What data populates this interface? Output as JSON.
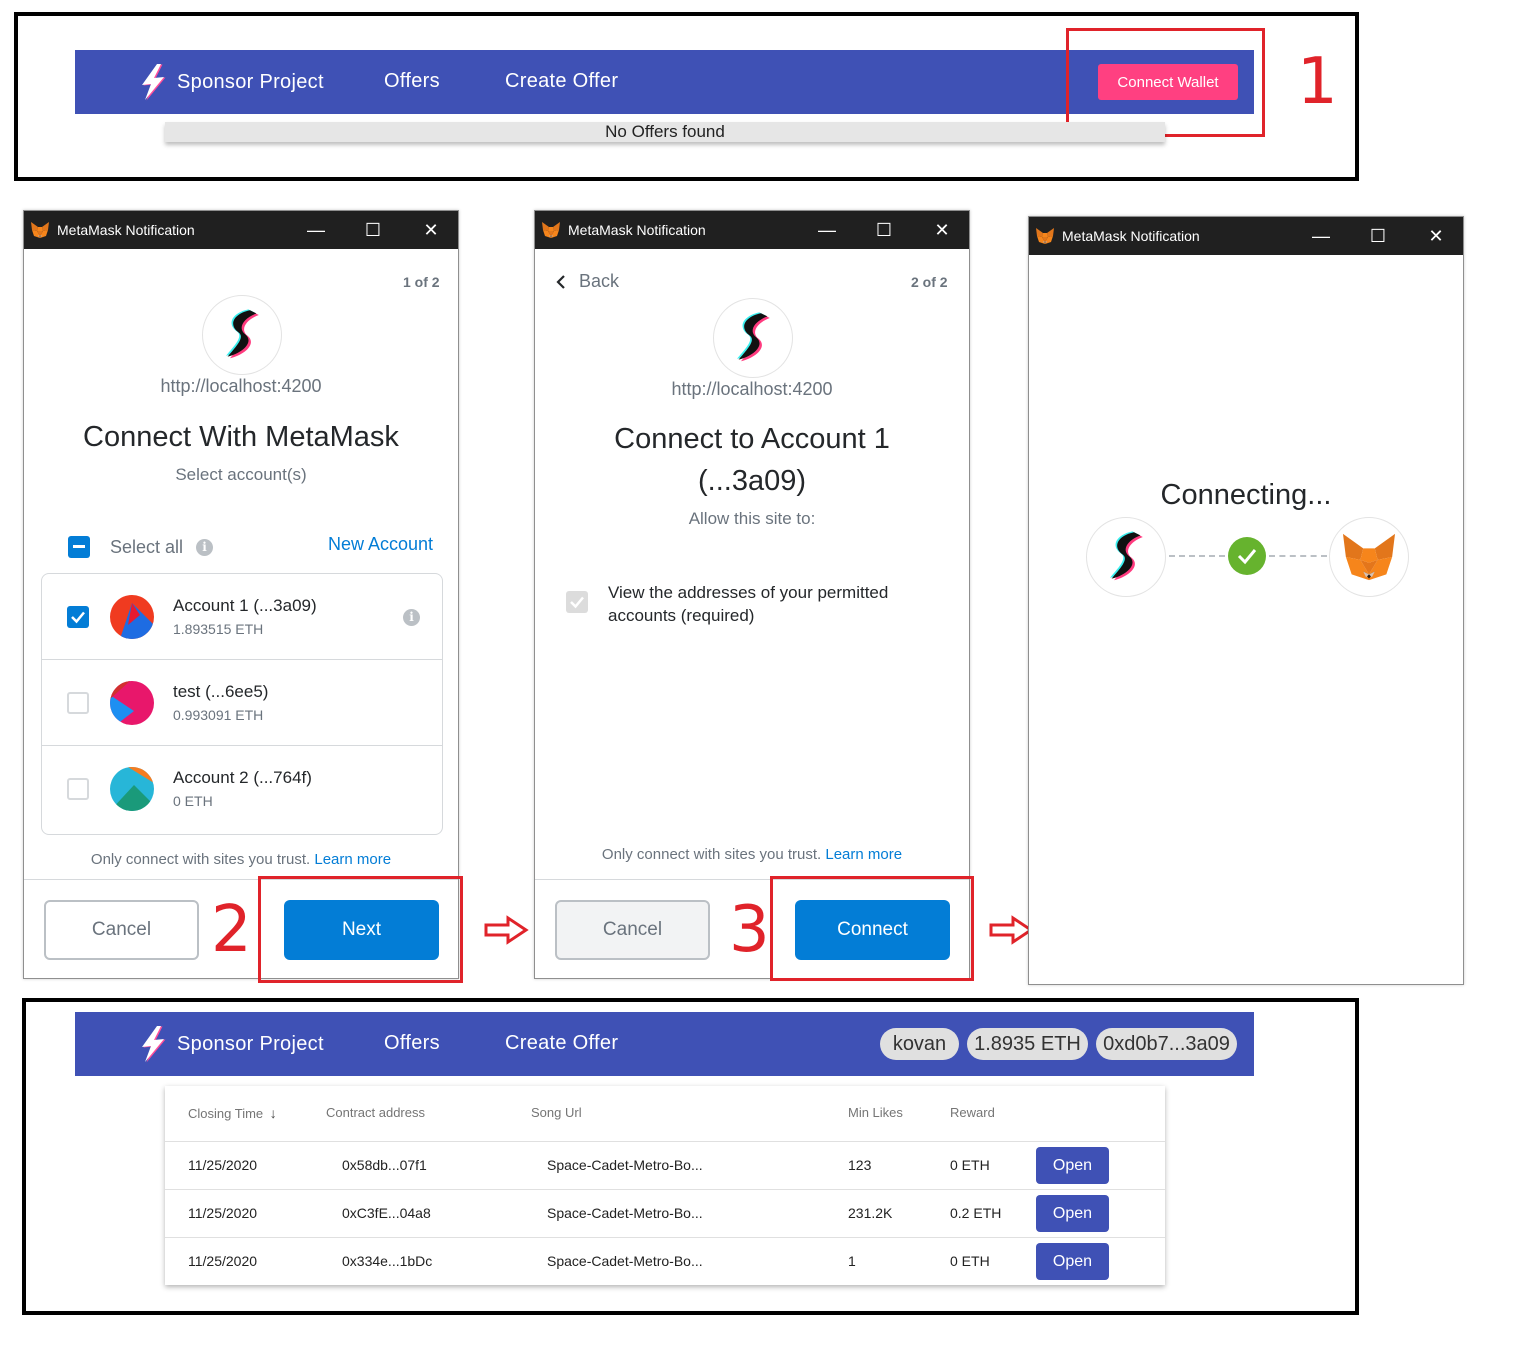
{
  "app": {
    "brand": "Sponsor Project",
    "nav": [
      "Offers",
      "Create Offer"
    ],
    "connect_wallet": "Connect Wallet",
    "no_offers": "No Offers found"
  },
  "steps": [
    "1",
    "2",
    "3"
  ],
  "colors": {
    "navbar": "#3f51b5",
    "pink": "#ff4081",
    "metamask_blue": "#037dd6",
    "annotation_red": "#e0232a",
    "success_green": "#66b32e"
  },
  "mm_title": "MetaMask Notification",
  "dialog1": {
    "counter": "1 of 2",
    "origin": "http://localhost:4200",
    "heading": "Connect With MetaMask",
    "subheading": "Select account(s)",
    "select_all": "Select all",
    "new_account": "New Account",
    "accounts": [
      {
        "name": "Account 1 (...3a09)",
        "balance": "1.893515 ETH",
        "checked": true
      },
      {
        "name": "test (...6ee5)",
        "balance": "0.993091 ETH",
        "checked": false
      },
      {
        "name": "Account 2 (...764f)",
        "balance": "0 ETH",
        "checked": false
      }
    ],
    "trust_note": "Only connect with sites you trust.",
    "learn_more": "Learn more",
    "cancel": "Cancel",
    "next": "Next"
  },
  "dialog2": {
    "back": "Back",
    "counter": "2 of 2",
    "origin": "http://localhost:4200",
    "heading_line1": "Connect to Account 1",
    "heading_line2": "(...3a09)",
    "subheading": "Allow this site to:",
    "permission_line1": "View the addresses of your permitted",
    "permission_line2": "accounts (required)",
    "trust_note": "Only connect with sites you trust.",
    "learn_more": "Learn more",
    "cancel": "Cancel",
    "connect": "Connect"
  },
  "dialog3": {
    "heading": "Connecting..."
  },
  "connected": {
    "network": "kovan",
    "balance": "1.8935 ETH",
    "address": "0xd0b7...3a09",
    "columns": [
      "Closing Time",
      "Contract address",
      "Song Url",
      "Min Likes",
      "Reward"
    ],
    "rows": [
      {
        "closing": "11/25/2020",
        "contract": "0x58db...07f1",
        "song": "Space-Cadet-Metro-Bo...",
        "likes": "123",
        "reward": "0 ETH",
        "action": "Open"
      },
      {
        "closing": "11/25/2020",
        "contract": "0xC3fE...04a8",
        "song": "Space-Cadet-Metro-Bo...",
        "likes": "231.2K",
        "reward": "0.2 ETH",
        "action": "Open"
      },
      {
        "closing": "11/25/2020",
        "contract": "0x334e...1bDc",
        "song": "Space-Cadet-Metro-Bo...",
        "likes": "1",
        "reward": "0 ETH",
        "action": "Open"
      }
    ]
  }
}
